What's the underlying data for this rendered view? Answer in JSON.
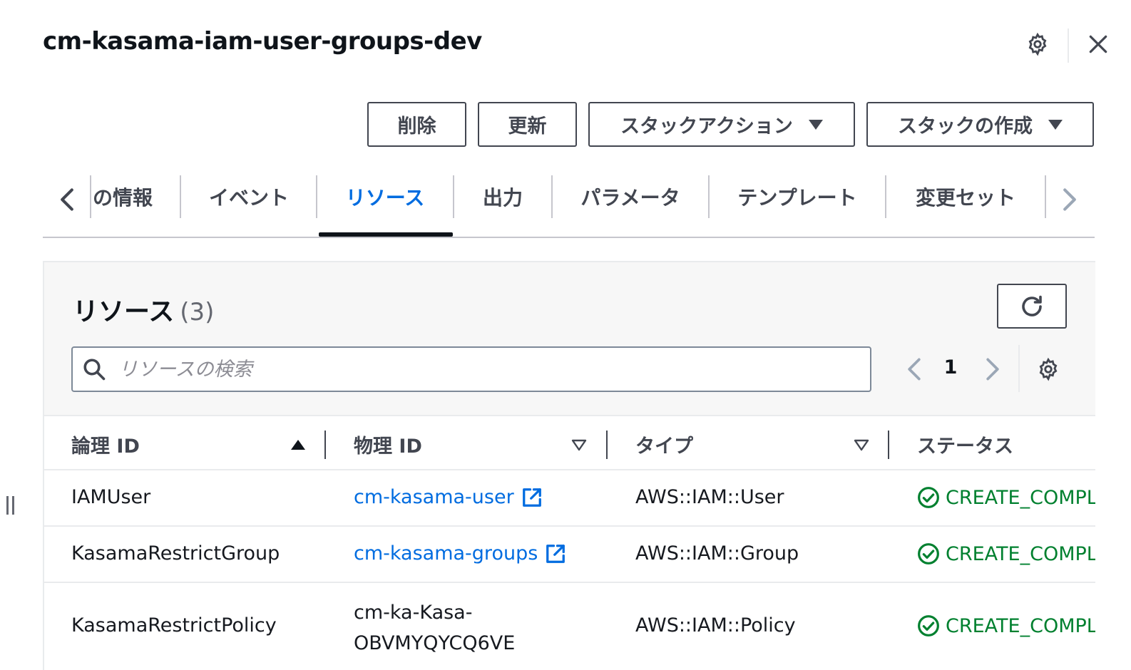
{
  "header": {
    "title": "cm-kasama-iam-user-groups-dev",
    "settings_icon": "gear-icon",
    "close_icon": "close-icon"
  },
  "actions": {
    "delete_label": "削除",
    "update_label": "更新",
    "stack_actions_label": "スタックアクション",
    "create_stack_label": "スタックの作成"
  },
  "tabs": {
    "items": [
      {
        "label": "の情報"
      },
      {
        "label": "イベント"
      },
      {
        "label": "リソース"
      },
      {
        "label": "出力"
      },
      {
        "label": "パラメータ"
      },
      {
        "label": "テンプレート"
      },
      {
        "label": "変更セット"
      }
    ],
    "active": "リソース"
  },
  "resources": {
    "title": "リソース",
    "count": "(3)",
    "search_placeholder": "リソースの検索",
    "page": "1",
    "columns": [
      {
        "label": "論理 ID"
      },
      {
        "label": "物理 ID"
      },
      {
        "label": "タイプ"
      },
      {
        "label": "ステータス"
      }
    ],
    "rows": [
      {
        "logical_id": "IAMUser",
        "physical_id": "cm-kasama-user",
        "type": "AWS::IAM::User",
        "status": "CREATE_COMPLETE"
      },
      {
        "logical_id": "KasamaRestrictGroup",
        "physical_id": "cm-kasama-groups",
        "type": "AWS::IAM::Group",
        "status": "CREATE_COMPLETE"
      },
      {
        "logical_id": "KasamaRestrictPolicy",
        "physical_id": "cm-ka-Kasa-OBVMYQYCQ6VE",
        "type": "AWS::IAM::Policy",
        "status": "CREATE_COMPLETE"
      }
    ]
  },
  "colors": {
    "link": "#006ce0",
    "success": "#00802f",
    "border": "#424650"
  }
}
